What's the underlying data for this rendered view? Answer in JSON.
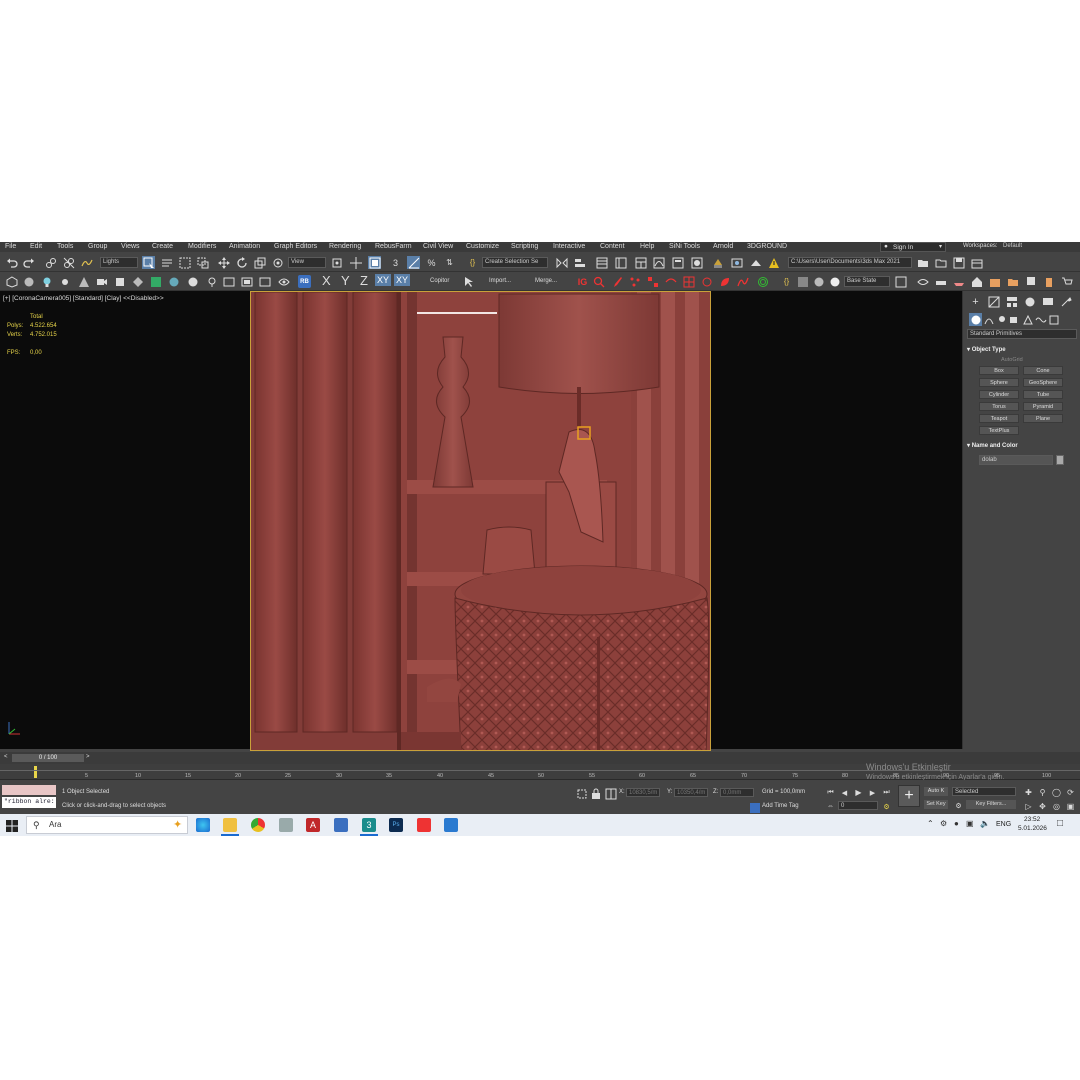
{
  "menu": [
    "File",
    "Edit",
    "Tools",
    "Group",
    "Views",
    "Create",
    "Modifiers",
    "Animation",
    "Graph Editors",
    "Rendering",
    "RebusFarm",
    "Civil View",
    "Customize",
    "Scripting",
    "Interactive",
    "Content",
    "Help",
    "SiNi Tools",
    "Arnold",
    "3DGROUND"
  ],
  "signin_label": "Sign In",
  "workspaces_label": "Workspaces:",
  "workspaces_value": "Default",
  "toolbar": {
    "lights_dropdown": "Lights",
    "view_dropdown": "View",
    "selection_set_dropdown": "Create Selection Se",
    "path_dropdown": "C:\\Users\\User\\Documents\\3ds Max 2021",
    "copitor_label": "Copitor",
    "import_label": "Import...",
    "merge_label": "Merge...",
    "axis_x": "X",
    "axis_y": "Y",
    "axis_z": "Z",
    "axis_xy": "XY",
    "axis_xy2": "XY",
    "base_state": "Base State"
  },
  "viewport": {
    "label": "[+] [CoronaCamera005] [Standard] [Clay] <<Disabled>>",
    "stats_total": "Total",
    "polys_label": "Polys:",
    "polys_value": "4.522.654",
    "verts_label": "Verts:",
    "verts_value": "4.752.015",
    "fps_label": "FPS:",
    "fps_value": "0,00"
  },
  "command_panel": {
    "dropdown": "Standard Primitives",
    "object_type_title": "Object Type",
    "autogrid": "AutoGrid",
    "buttons": [
      "Box",
      "Cone",
      "Sphere",
      "GeoSphere",
      "Cylinder",
      "Tube",
      "Torus",
      "Pyramid",
      "Teapot",
      "Plane",
      "TextPlus"
    ],
    "name_color_title": "Name and Color",
    "object_name": "dolab"
  },
  "timeline": {
    "frame_counter": "0 / 100",
    "ticks": [
      "5",
      "10",
      "15",
      "20",
      "25",
      "30",
      "35",
      "40",
      "45",
      "50",
      "55",
      "60",
      "65",
      "70",
      "75",
      "80",
      "85",
      "90",
      "95",
      "100"
    ]
  },
  "status": {
    "maxscript_text": "\"ribbon alre:",
    "selected_text": "1 Object Selected",
    "prompt_text": "Click or click-and-drag to select objects",
    "x_label": "X:",
    "x_value": "10830,5/m",
    "y_label": "Y:",
    "y_value": "10350,4/m",
    "z_label": "Z:",
    "z_value": "0,0mm",
    "grid_text": "Grid = 100,0mm",
    "add_time_tag": "Add Time Tag",
    "auto_key": "Auto K",
    "set_key": "Set Key",
    "selected_dropdown": "Selected",
    "key_filters": "Key Filters...",
    "frame_value": "0"
  },
  "watermark": {
    "line1": "Windows'u Etkinleştir",
    "line2": "Windows'u etkinleştirmek için Ayarlar'a gidin."
  },
  "taskbar": {
    "search_placeholder": "Ara",
    "language": "ENG",
    "time": "23:52",
    "date": "5.01.2026"
  },
  "colors": {
    "clay": "#8a3f3b",
    "viewport_border": "#c9a13a",
    "ui_bg": "#444444",
    "stats_yellow": "#e8d54a"
  }
}
